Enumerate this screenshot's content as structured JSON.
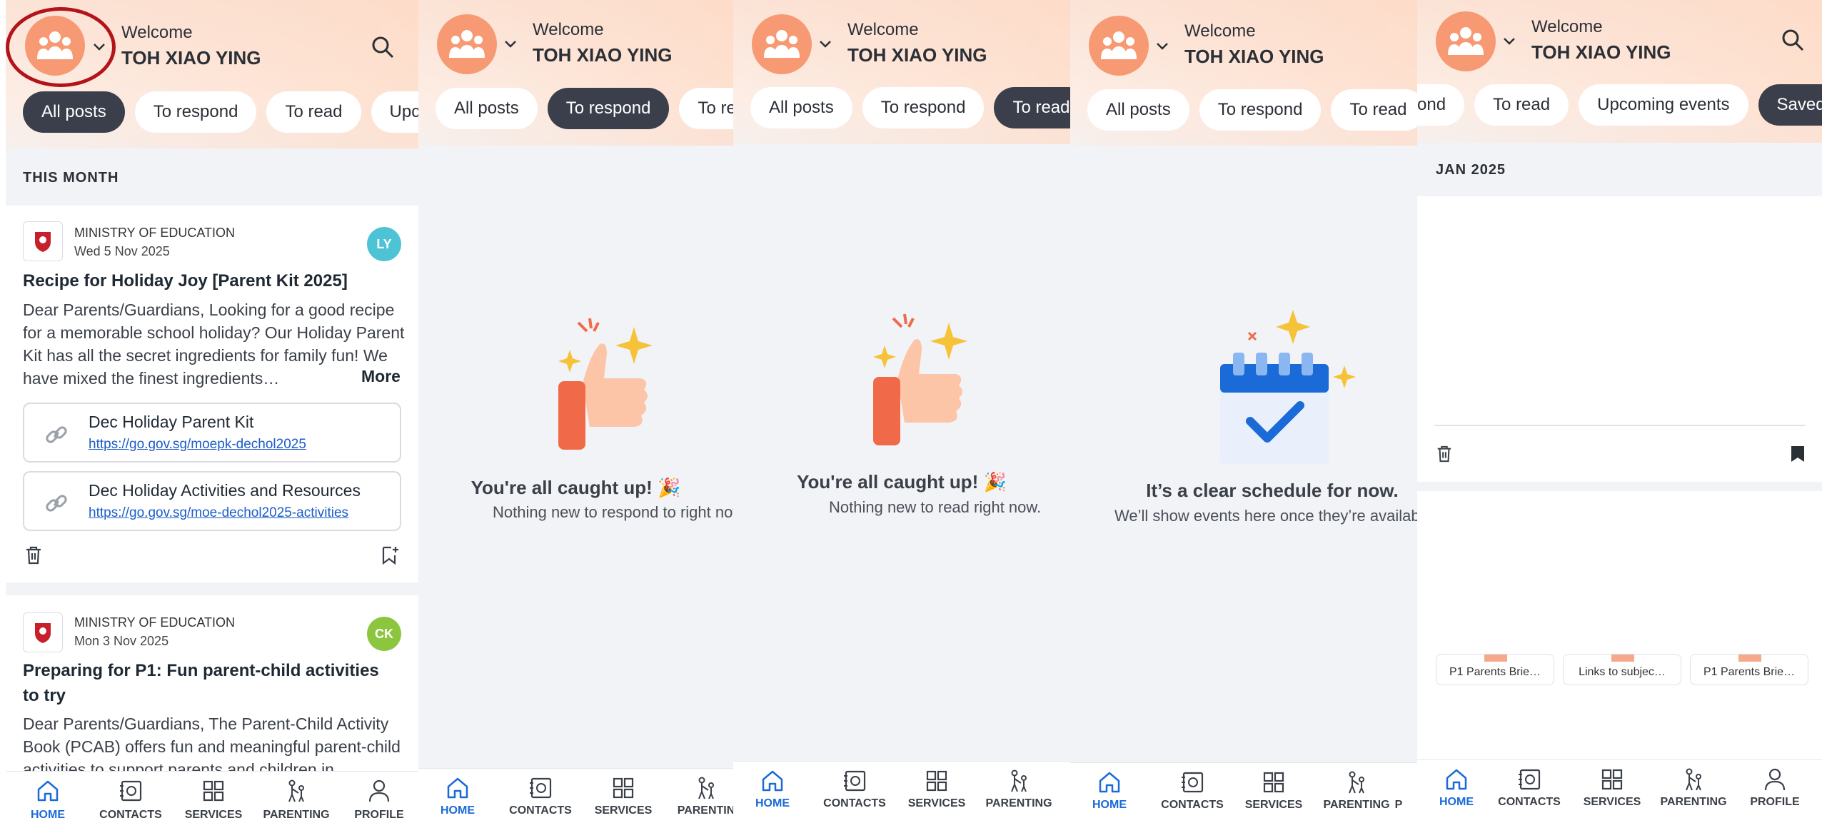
{
  "user": {
    "welcome": "Welcome",
    "name": "TOH XIAO YING"
  },
  "tabs": {
    "all_posts": "All posts",
    "to_respond": "To respond",
    "to_read": "To read",
    "upcoming_events": "Upcoming events",
    "upcoming_truncated": "Upcomi",
    "to_read_truncated": "To read",
    "respond_truncated": "ond",
    "saved": "Saved"
  },
  "feed": {
    "section": "THIS MONTH",
    "posts": [
      {
        "org": "MINISTRY OF EDUCATION",
        "date": "Wed 5 Nov 2025",
        "badge": "LY",
        "badge_color": "#4fc3d6",
        "title": "Recipe for Holiday Joy [Parent Kit 2025]",
        "body": "Dear Parents/Guardians, Looking for a good recipe for a memorable school holiday? Our Holiday Parent Kit has all the secret ingredients for family fun! We have mixed the finest ingredients…",
        "more": "More",
        "links": [
          {
            "title": "Dec Holiday Parent Kit",
            "url": "https://go.gov.sg/moepk-dechol2025"
          },
          {
            "title": "Dec Holiday Activities and Resources",
            "url": "https://go.gov.sg/moe-dechol2025-activities"
          }
        ]
      },
      {
        "org": "MINISTRY OF EDUCATION",
        "date": "Mon 3 Nov 2025",
        "badge": "CK",
        "badge_color": "#8cc63f",
        "title": "Preparing for P1: Fun parent-child activities to try",
        "body": "Dear Parents/Guardians, The Parent-Child Activity Book (PCAB) offers fun and meaningful parent-child activities to support parents and children in"
      }
    ]
  },
  "empty_respond": {
    "title": "You're all caught up! 🎉",
    "sub": "Nothing new to respond to right now."
  },
  "empty_read": {
    "title": "You're all caught up! 🎉",
    "sub": "Nothing new to read right now."
  },
  "empty_events": {
    "title": "It’s a clear schedule for now.",
    "sub": "We’ll show events here once they’re available."
  },
  "saved": {
    "section": "JAN 2025",
    "thumbs": [
      "P1 Parents Brie…",
      "Links to subjec…",
      "P1 Parents Brie…"
    ]
  },
  "nav": {
    "home": "HOME",
    "contacts": "CONTACTS",
    "services": "SERVICES",
    "parenting": "PARENTING",
    "profile": "PROFILE",
    "parenting_truncated": "PARENTIN",
    "profile_truncated": "P"
  },
  "colors": {
    "accent": "#1a6ad8",
    "avatar": "#f79a73",
    "chip_active": "#3a3f4b",
    "ring": "#b3141a"
  }
}
